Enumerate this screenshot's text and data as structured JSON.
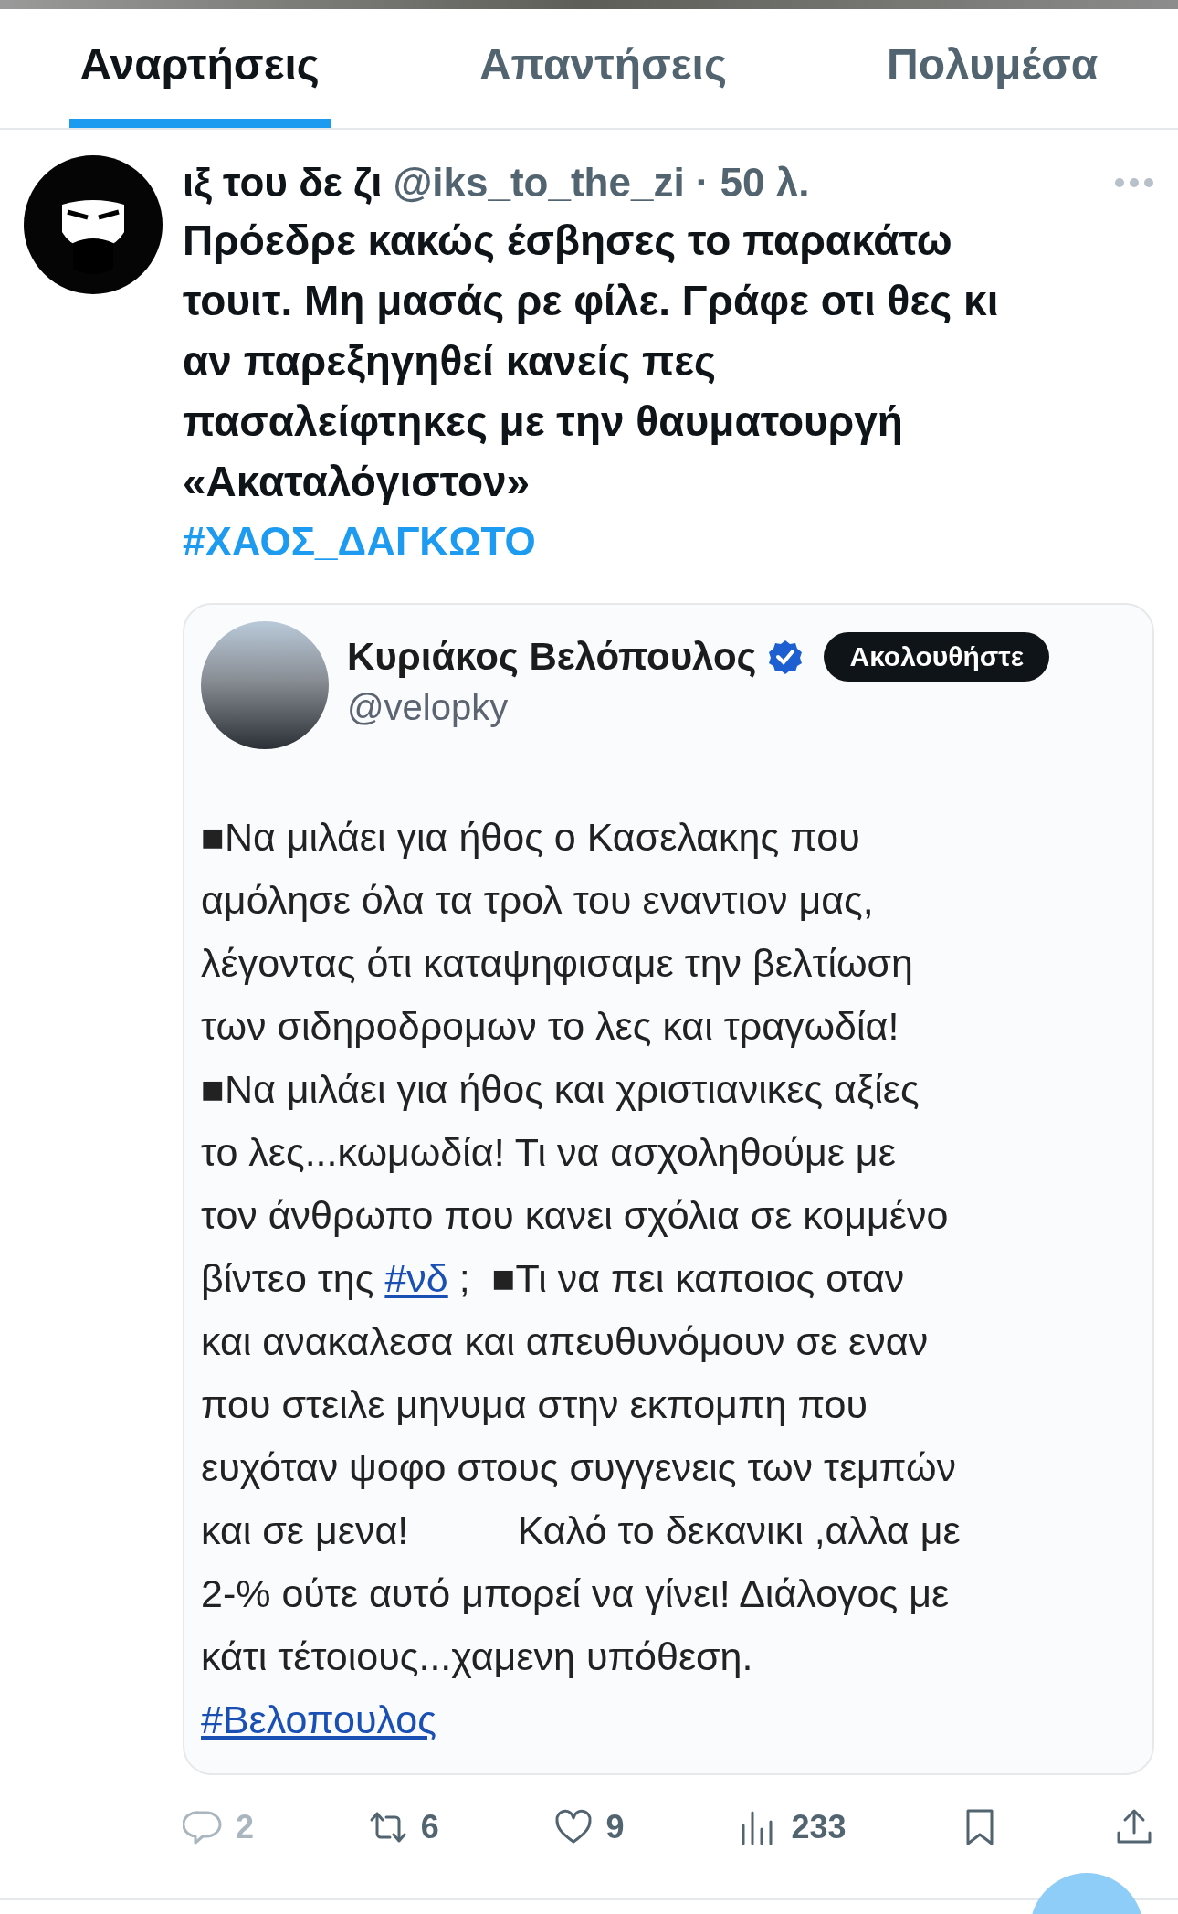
{
  "tabs": [
    {
      "label": "Αναρτήσεις",
      "selected": true
    },
    {
      "label": "Απαντήσεις",
      "selected": false
    },
    {
      "label": "Πολυμέσα",
      "selected": false
    }
  ],
  "post": {
    "author": {
      "name": "ιξ του δε ζι",
      "handle": "@iks_to_the_zi",
      "time": "· 50 λ."
    },
    "text_lines": [
      "Πρόεδρε κακώς έσβησες το παρακάτω",
      "τουιτ. Μη μασάς ρε φίλε. Γράφε οτι θες κι",
      "αν παρεξηγηθεί κανείς πες",
      "πασαλείφτηκες με την θαυματουργή",
      "«Ακαταλόγιστον»"
    ],
    "hashtag": "#ΧΑΟΣ_ΔΑΓΚΩΤΟ",
    "quoted": {
      "name": "Κυριάκος Βελόπουλος",
      "verified": true,
      "handle": "@velopky",
      "follow_button": "Ακολουθήστε",
      "lines": [
        [
          {
            "kind": "text",
            "text": "■Να μιλάει για ήθος ο Κασελακης που"
          }
        ],
        [
          {
            "kind": "text",
            "text": "αμόλησε όλα τα τρολ του εναντιον μας,"
          }
        ],
        [
          {
            "kind": "text",
            "text": "λέγοντας ότι καταψηφισαμε την βελτίωση"
          }
        ],
        [
          {
            "kind": "text",
            "text": "των σιδηροδρομων το λες και τραγωδία!"
          }
        ],
        [
          {
            "kind": "text",
            "text": "■Να μιλάει για ήθος και χριστιανικες αξίες"
          }
        ],
        [
          {
            "kind": "text",
            "text": "το λες...κωμωδία! Τι να ασχοληθούμε με"
          }
        ],
        [
          {
            "kind": "text",
            "text": "τον άνθρωπο που κανει σχόλια σε κομμένο"
          }
        ],
        [
          {
            "kind": "text",
            "text": "βίντεο της "
          },
          {
            "kind": "link",
            "text": "#νδ"
          },
          {
            "kind": "text",
            "text": " ;  ■Τι να πει καποιος οταν"
          }
        ],
        [
          {
            "kind": "text",
            "text": "και ανακαλεσα και απευθυνόμουν σε εναν"
          }
        ],
        [
          {
            "kind": "text",
            "text": "που στειλε μηνυμα στην εκπομπη που"
          }
        ],
        [
          {
            "kind": "text",
            "text": "ευχόταν ψοφο στους συγγενεις των τεμπών"
          }
        ],
        [
          {
            "kind": "text",
            "text": "και σε μενα!          Καλό το δεκανικι ,αλλα με"
          }
        ],
        [
          {
            "kind": "text",
            "text": "2-% ούτε αυτό μπορεί να γίνει! Διάλογος με"
          }
        ],
        [
          {
            "kind": "text",
            "text": "κάτι τέτοιους...χαμενη υπόθεση."
          }
        ],
        [
          {
            "kind": "link",
            "text": "#Βελοπουλος"
          }
        ]
      ]
    },
    "actions": [
      {
        "kind": "reply",
        "count": "2",
        "disabled": true
      },
      {
        "kind": "repost",
        "count": "6",
        "disabled": false
      },
      {
        "kind": "like",
        "count": "9",
        "disabled": false
      },
      {
        "kind": "views",
        "count": "233",
        "disabled": false
      },
      {
        "kind": "bookmark",
        "disabled": false
      },
      {
        "kind": "share",
        "disabled": false
      }
    ]
  }
}
